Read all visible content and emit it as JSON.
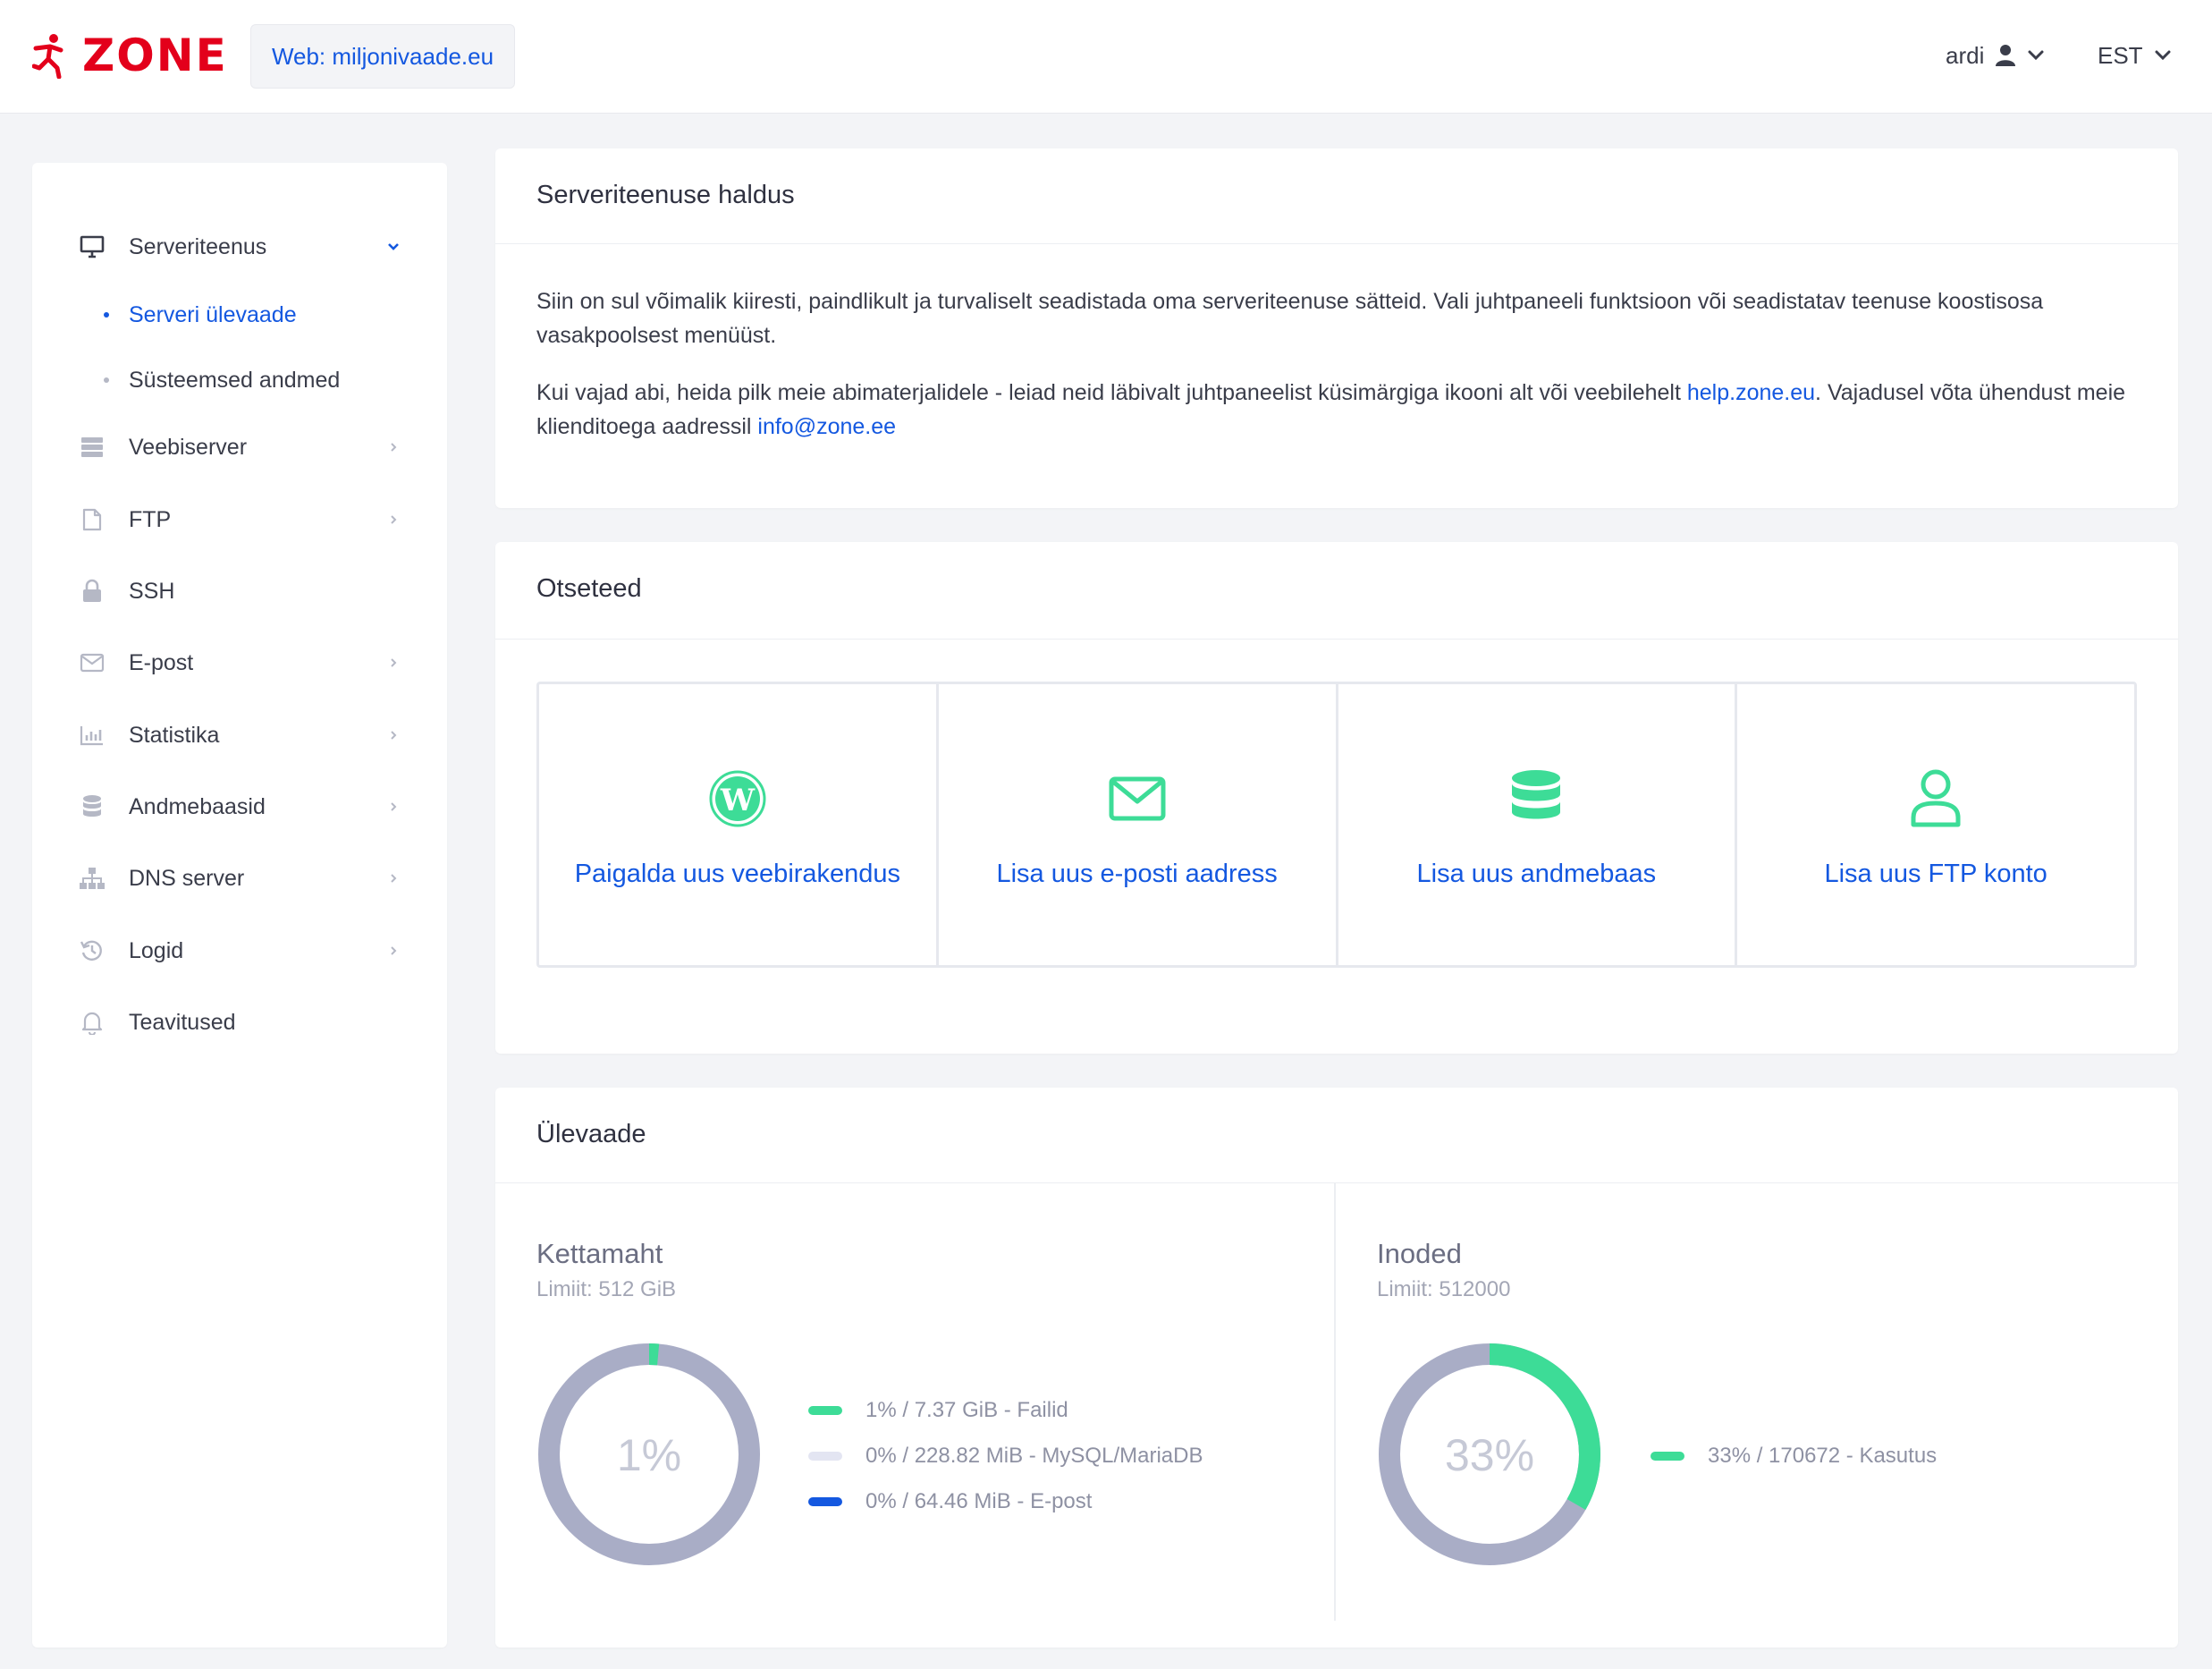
{
  "header": {
    "brand": "ZONE",
    "domain_chip": "Web: miljonivaade.eu",
    "user": "ardi",
    "language": "EST"
  },
  "sidebar": {
    "items": [
      {
        "label": "Serveriteenus",
        "icon": "monitor-icon",
        "expanded": true
      },
      {
        "label": "Veebiserver",
        "icon": "server-icon"
      },
      {
        "label": "FTP",
        "icon": "file-icon"
      },
      {
        "label": "SSH",
        "icon": "lock-icon"
      },
      {
        "label": "E-post",
        "icon": "mail-icon"
      },
      {
        "label": "Statistika",
        "icon": "bar-chart-icon"
      },
      {
        "label": "Andmebaasid",
        "icon": "database-icon"
      },
      {
        "label": "DNS server",
        "icon": "sitemap-icon"
      },
      {
        "label": "Logid",
        "icon": "history-icon"
      },
      {
        "label": "Teavitused",
        "icon": "bell-icon"
      }
    ],
    "subitems": [
      {
        "label": "Serveri ülevaade",
        "active": true
      },
      {
        "label": "Süsteemsed andmed",
        "active": false
      }
    ]
  },
  "intro": {
    "title": "Serveriteenuse haldus",
    "para1": "Siin on sul võimalik kiiresti, paindlikult ja turvaliselt seadistada oma serveriteenuse sätteid. Vali juhtpaneeli funktsioon või seadistatav teenuse koostisosa vasakpoolsest menüüst.",
    "para2_a": "Kui vajad abi, heida pilk meie abimaterjalidele - leiad neid läbivalt juhtpaneelist küsimärgiga ikooni alt või veebilehelt ",
    "help_link": "help.zone.eu",
    "para2_b": ". Vajadusel võta ühendust meie klienditoega aadressil ",
    "email_link": "info@zone.ee"
  },
  "shortcuts": {
    "title": "Otseteed",
    "items": [
      {
        "label": "Paigalda uus veebirakendus",
        "icon": "wordpress-icon"
      },
      {
        "label": "Lisa uus e-posti aadress",
        "icon": "envelope-icon"
      },
      {
        "label": "Lisa uus andmebaas",
        "icon": "database-icon"
      },
      {
        "label": "Lisa uus FTP konto",
        "icon": "user-icon"
      }
    ]
  },
  "overview": {
    "title": "Ülevaade",
    "disk": {
      "title": "Kettamaht",
      "limit": "Limiit: 512 GiB",
      "center": "1%",
      "legend": [
        {
          "text": "1% / 7.37 GiB - Failid",
          "color": "#3ddc97"
        },
        {
          "text": "0% / 228.82 MiB - MySQL/MariaDB",
          "color": "#e3e5f2"
        },
        {
          "text": "0% / 64.46 MiB - E-post",
          "color": "#1458e0"
        }
      ],
      "used_fraction": 0.0144
    },
    "inodes": {
      "title": "Inoded",
      "limit": "Limiit: 512000",
      "center": "33%",
      "legend": [
        {
          "text": "33% / 170672 - Kasutus",
          "color": "#3ddc97"
        }
      ],
      "used_fraction": 0.3333
    }
  },
  "colors": {
    "accent": "#1458e0",
    "brand": "#e3001b",
    "green": "#3ddc97",
    "donut_track": "#a9adc6"
  }
}
